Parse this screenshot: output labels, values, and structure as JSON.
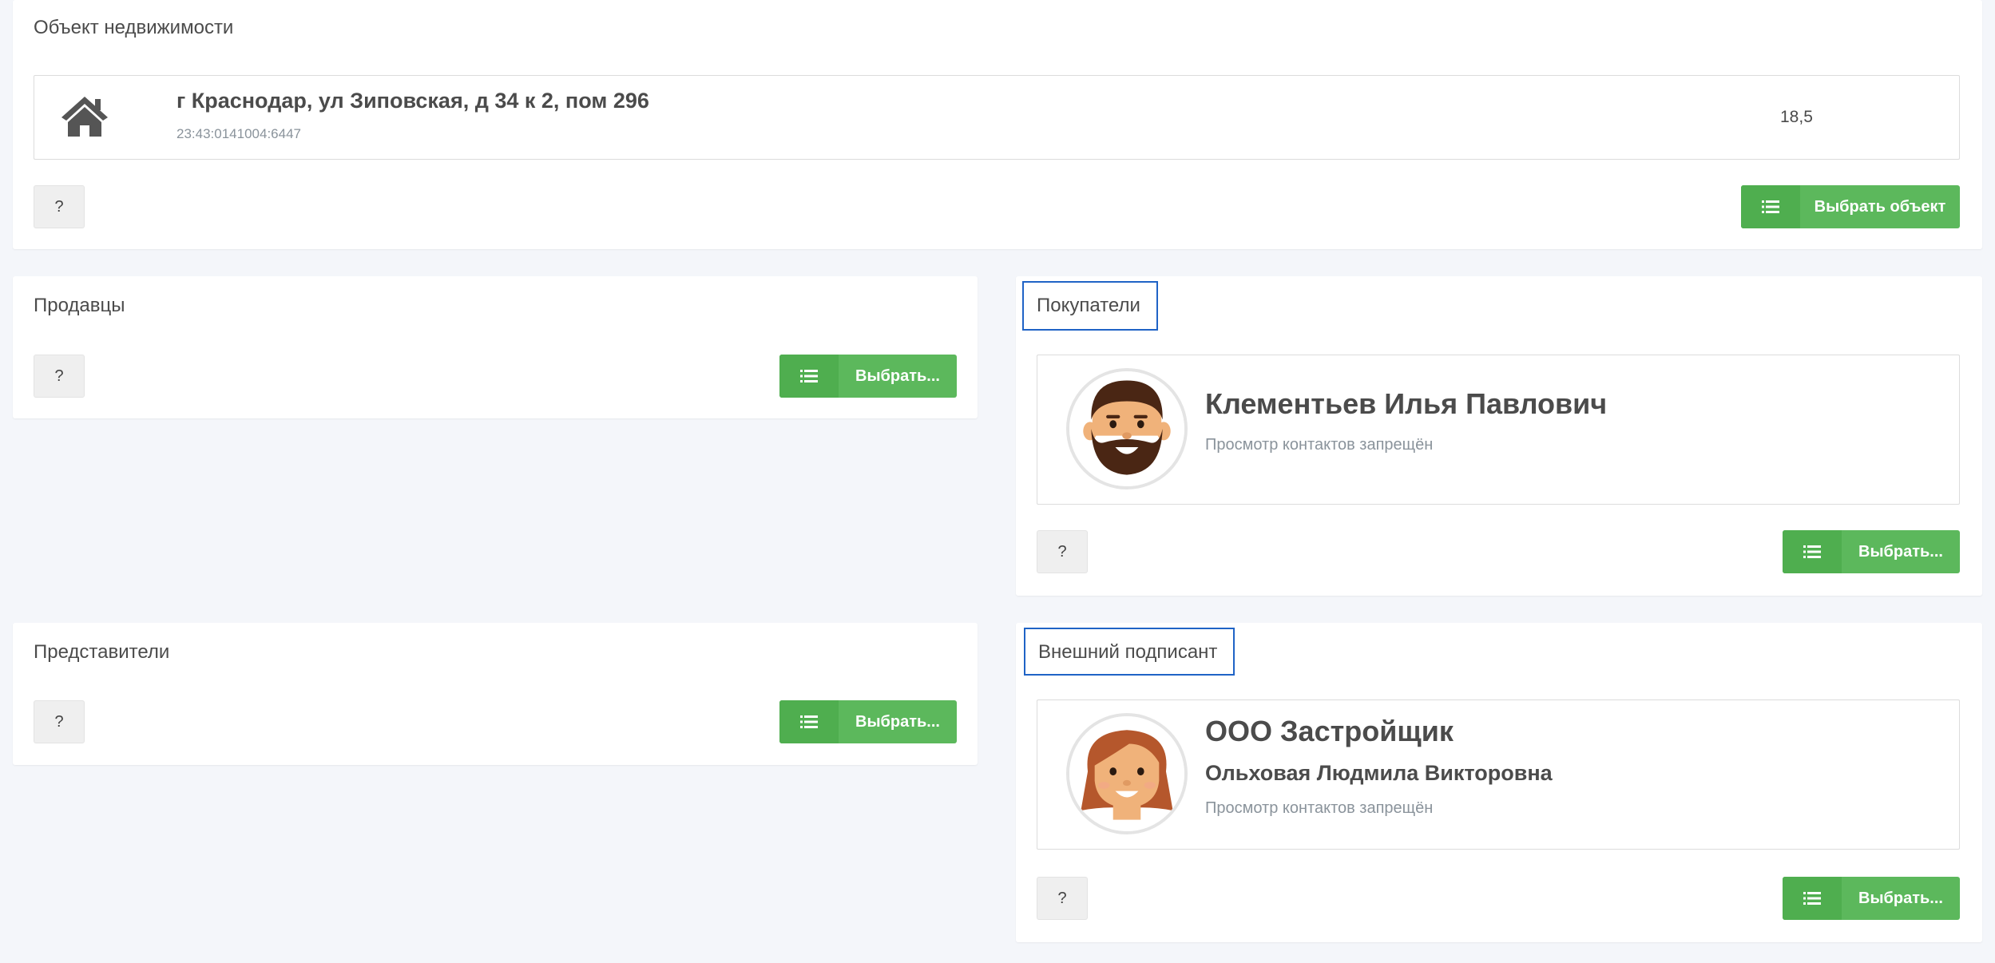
{
  "property": {
    "title": "Объект недвижимости",
    "address": "г Краснодар, ул Зиповская, д 34 к 2, пом 296",
    "cadastral": "23:43:0141004:6447",
    "area": "18,5",
    "icon": "house-icon",
    "help_label": "?",
    "select_label": "Выбрать объект"
  },
  "sellers": {
    "title": "Продавцы",
    "help_label": "?",
    "select_label": "Выбрать..."
  },
  "buyers": {
    "title": "Покупатели",
    "help_label": "?",
    "select_label": "Выбрать...",
    "person": {
      "name": "Клементьев Илья Павлович",
      "note": "Просмотр контактов запрещён",
      "avatar": "male-avatar-icon"
    }
  },
  "representatives": {
    "title": "Представители",
    "help_label": "?",
    "select_label": "Выбрать..."
  },
  "external_signer": {
    "title": "Внешний подписант",
    "help_label": "?",
    "select_label": "Выбрать...",
    "org": {
      "name": "ООО Застройщик",
      "person": "Ольховая Людмила Викторовна",
      "note": "Просмотр контактов запрещён",
      "avatar": "female-avatar-icon"
    }
  },
  "colors": {
    "accent_green": "#5cb85c",
    "focus_border": "#1f63c6",
    "background": "#f4f6fa"
  }
}
